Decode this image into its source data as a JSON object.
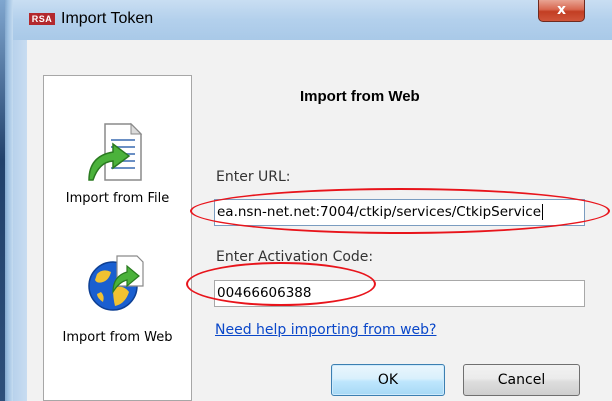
{
  "window": {
    "title": "Import Token",
    "logo_text": "RSA",
    "close_glyph": "x"
  },
  "sidebar": {
    "items": [
      {
        "label": "Import from File",
        "icon": "import-file-icon"
      },
      {
        "label": "Import from Web",
        "icon": "import-web-icon"
      }
    ]
  },
  "main": {
    "heading": "Import from Web",
    "url_label": "Enter URL:",
    "url_value": "ea.nsn-net.net:7004/ctkip/services/CtkipService",
    "code_label": "Enter Activation Code:",
    "code_value": "00466606388",
    "help_link": "Need help importing from web?"
  },
  "buttons": {
    "ok_label": "OK",
    "cancel_label": "Cancel"
  },
  "colors": {
    "annotation": "#e8141b",
    "link": "#0a47c9",
    "logo_bg": "#b3282d"
  }
}
